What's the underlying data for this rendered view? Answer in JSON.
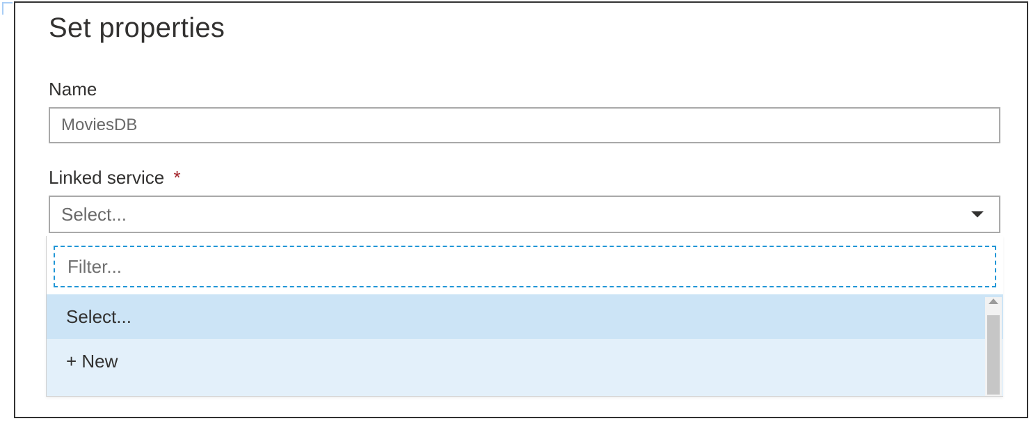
{
  "page": {
    "title": "Set properties"
  },
  "name_field": {
    "label": "Name",
    "value": "MoviesDB"
  },
  "linked_service": {
    "label": "Linked service",
    "required_mark": "*",
    "placeholder": "Select...",
    "filter_placeholder": "Filter...",
    "options": [
      {
        "label": "Select...",
        "highlighted": true
      },
      {
        "label": "+ New",
        "highlighted": false
      }
    ]
  }
}
